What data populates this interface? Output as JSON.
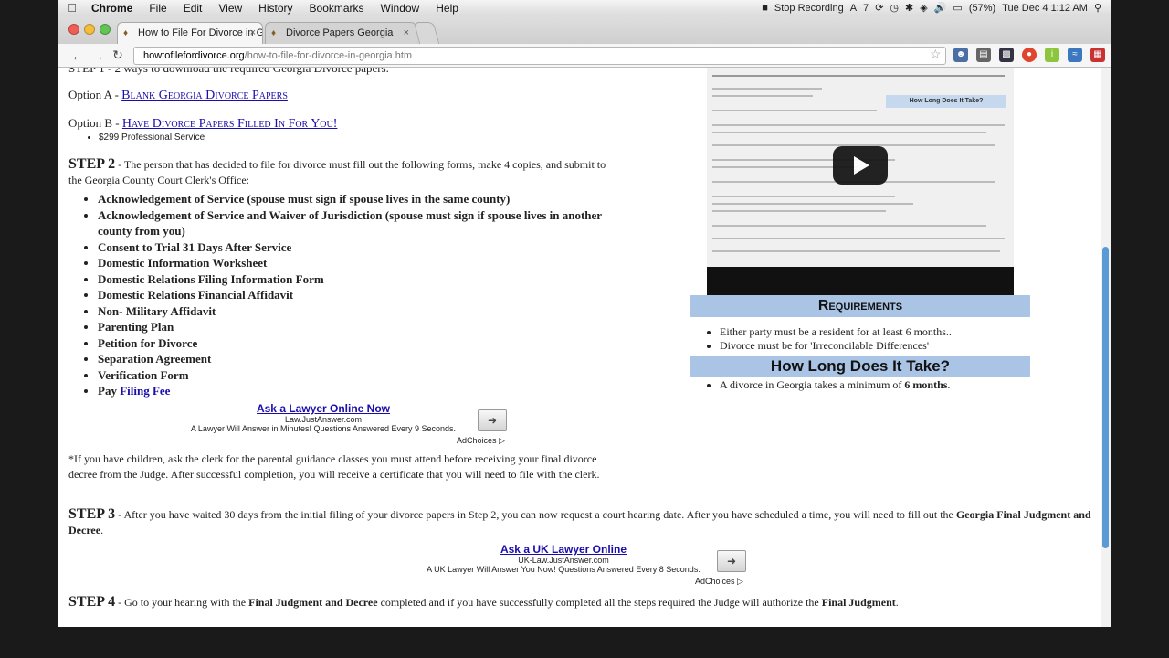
{
  "menubar": {
    "apple": "",
    "app": "Chrome",
    "items": [
      "File",
      "Edit",
      "View",
      "History",
      "Bookmarks",
      "Window",
      "Help"
    ],
    "status": {
      "recording": "Stop Recording",
      "adobe": "7",
      "battery": "(57%)",
      "clock": "Tue Dec 4  1:12 AM"
    }
  },
  "tabs": [
    {
      "title": "How to File For Divorce in Ge",
      "active": true
    },
    {
      "title": "Divorce Papers Georgia",
      "active": false
    }
  ],
  "url": {
    "host": "howtofilefordivorce.org",
    "path": "/how-to-file-for-divorce-in-georgia.htm"
  },
  "page": {
    "top_cut": "STEP 1 - 2 ways to download the required Georgia Divorce papers.",
    "optionA_label": "Option A -",
    "optionA_link": "Blank Georgia Divorce Papers",
    "optionB_label": "Option B -",
    "optionB_link": "Have Divorce Papers Filled In For You!",
    "optionB_price": "$299 Professional Service",
    "step2_title": "STEP 2",
    "step2_text": " - The person that has decided to file for divorce must fill out the following forms, make 4 copies, and submit to the Georgia County Court Clerk's Office:",
    "forms": [
      "Acknowledgement of Service (spouse must sign if spouse lives in the same county)",
      "Acknowledgement of Service and Waiver of Jurisdiction (spouse must sign if spouse lives in another county from you)",
      "Consent to Trial 31 Days After Service",
      "Domestic Information Worksheet",
      "Domestic Relations Filing Information Form",
      "Domestic Relations Financial Affidavit",
      "Non- Military Affidavit",
      "Parenting Plan",
      "Petition for Divorce",
      "Separation Agreement",
      "Verification Form"
    ],
    "pay_label": "Pay ",
    "pay_link": "Filing Fee",
    "ad1": {
      "title": "Ask a Lawyer Online Now",
      "domain": "Law.JustAnswer.com",
      "desc": "A Lawyer Will Answer in Minutes! Questions Answered Every 9 Seconds.",
      "choices": "AdChoices ▷"
    },
    "children_note": "*If you have children, ask the clerk for the parental guidance classes you must attend before receiving your final divorce decree from the Judge. After successful completion, you will receive a certificate that you will need to file with the clerk.",
    "step3_title": "STEP 3",
    "step3_text": " - After you have waited 30 days from the initial filing of your divorce papers in Step 2, you can now request a court hearing date. After you have scheduled a time, you will need to fill out the ",
    "step3_bold": "Georgia Final Judgment and Decree",
    "step3_end": ".",
    "ad2": {
      "title": "Ask a UK Lawyer Online",
      "domain": "UK-Law.JustAnswer.com",
      "desc": "A UK Lawyer Will Answer You Now! Questions Answered Every 8 Seconds.",
      "choices": "AdChoices ▷"
    },
    "step4_title": "STEP 4",
    "step4_a": " - Go to your hearing with the ",
    "step4_b": "Final Judgment and Decree",
    "step4_c": " completed and if you have successfully completed all the steps required the Judge will authorize the ",
    "step4_d": "Final Judgment",
    "step4_e": "."
  },
  "sidebar": {
    "video_mini_title": "How Long Does It Take?",
    "requirements_title": "Requirements",
    "requirements": [
      "Either party must be a resident for at least 6 months..",
      "Divorce must be for 'Irreconcilable Differences'"
    ],
    "howlong_title": "How Long Does It Take?",
    "howlong_text": "A divorce in Georgia takes a minimum of ",
    "howlong_bold": "6 months",
    "howlong_end": "."
  },
  "colors": {
    "link": "#1a0dab",
    "sidebar_head": "#a9c4e4",
    "scroll_thumb": "#5b9bd5"
  }
}
